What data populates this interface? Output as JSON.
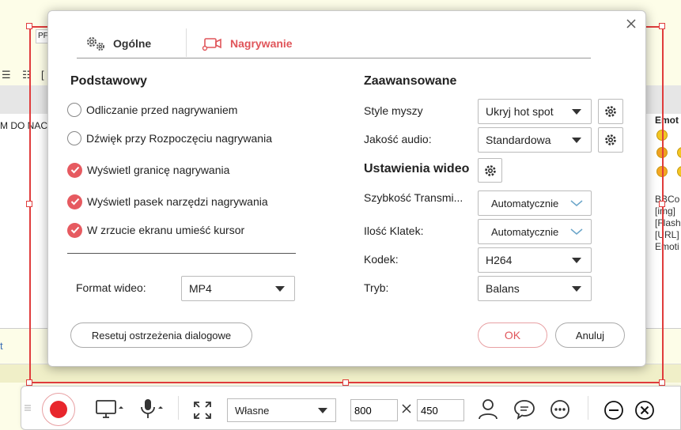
{
  "background": {
    "small_input_text": "PF",
    "editor_text": "M DO NAC",
    "link_text": "t",
    "right_panel_title": "Emot",
    "right_panel_lines": [
      "BBCo",
      "[img]",
      "[Flash",
      "[URL]",
      "Emoti"
    ]
  },
  "dialog": {
    "tabs": [
      {
        "label": "Ogólne",
        "icon": "gears-icon"
      },
      {
        "label": "Nagrywanie",
        "icon": "camera-icon"
      }
    ],
    "basic": {
      "title": "Podstawowy",
      "options": [
        {
          "label": "Odliczanie przed nagrywaniem",
          "checked": false
        },
        {
          "label": "Dźwięk przy Rozpoczęciu nagrywania",
          "checked": false
        },
        {
          "label": "Wyświetl granicę nagrywania",
          "checked": true
        },
        {
          "label": "Wyświetl pasek narzędzi nagrywania",
          "checked": true
        },
        {
          "label": "W zrzucie ekranu umieść kursor",
          "checked": true
        }
      ],
      "format_label": "Format wideo:",
      "format_value": "MP4"
    },
    "advanced": {
      "title": "Zaawansowane",
      "mouse_style_label": "Style myszy",
      "mouse_style_value": "Ukryj hot spot",
      "audio_quality_label": "Jakość audio:",
      "audio_quality_value": "Standardowa"
    },
    "video": {
      "title": "Ustawienia wideo",
      "bitrate_label": "Szybkość Transmi...",
      "bitrate_value": "Automatycznie",
      "framerate_label": "Ilość Klatek:",
      "framerate_value": "Automatycznie",
      "codec_label": "Kodek:",
      "codec_value": "H264",
      "mode_label": "Tryb:",
      "mode_value": "Balans"
    },
    "buttons": {
      "reset": "Resetuj ostrzeżenia dialogowe",
      "ok": "OK",
      "cancel": "Anuluj"
    }
  },
  "toolbar": {
    "region_value": "Własne",
    "width": "800",
    "height": "450"
  },
  "colors": {
    "accent": "#e65a60",
    "frame": "#e03c3c",
    "record": "#e8262c"
  }
}
